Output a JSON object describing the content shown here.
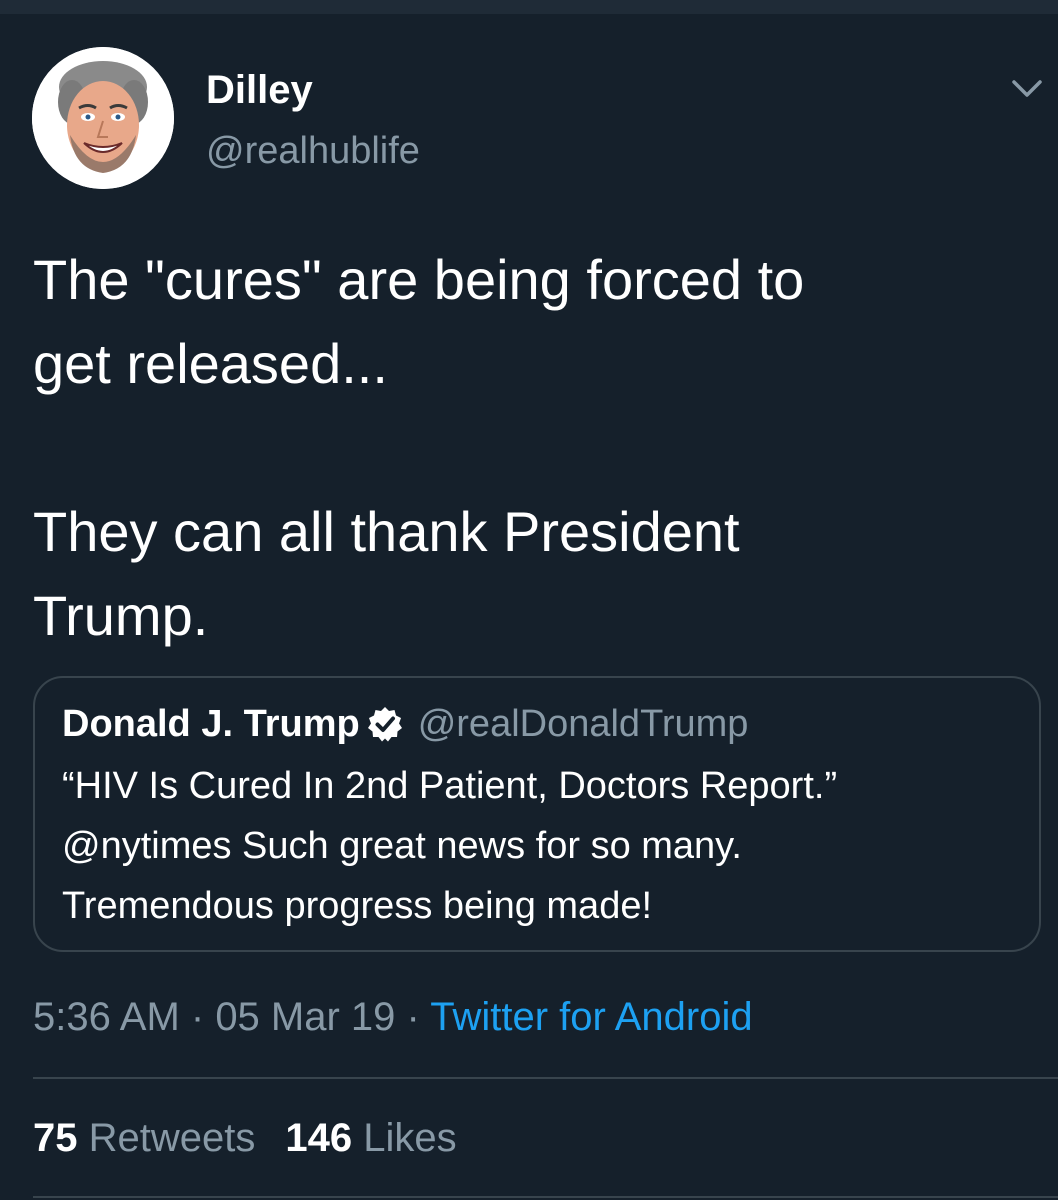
{
  "author": {
    "display_name": "Dilley",
    "handle": "@realhublife"
  },
  "tweet": {
    "text": "The \"cures\" are being forced to\nget released...\n\nThey can all thank President\nTrump."
  },
  "quoted_tweet": {
    "display_name": "Donald J. Trump",
    "handle": "@realDonaldTrump",
    "text": "“HIV Is Cured In 2nd Patient, Doctors Report.”\n@nytimes  Such great news for so many.\nTremendous progress being made!"
  },
  "meta": {
    "time": "5:36 AM",
    "separator": " · ",
    "date": "05 Mar 19",
    "source": "Twitter for Android"
  },
  "stats": {
    "retweets_count": "75",
    "retweets_label": "Retweets",
    "likes_count": "146",
    "likes_label": "Likes"
  },
  "colors": {
    "background": "#15202b",
    "text": "#ffffff",
    "secondary_text": "#8899a6",
    "link": "#1da1f2",
    "border": "#38444d"
  },
  "icons": {
    "menu": "chevron-down-icon",
    "verified": "verified-badge-icon"
  }
}
